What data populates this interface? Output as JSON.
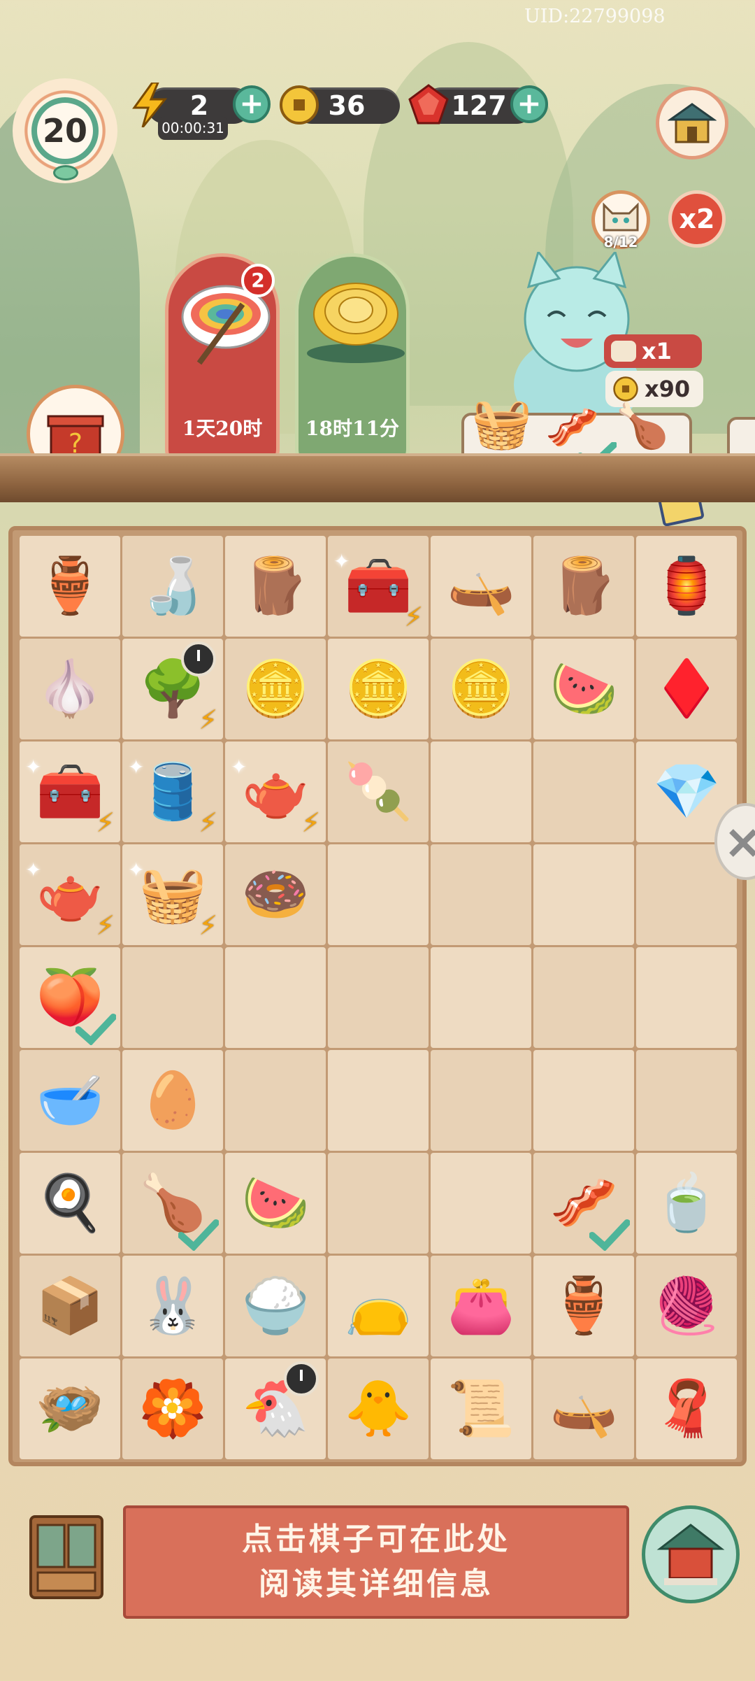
{
  "uid": "UID:22799098",
  "level": "20",
  "resources": {
    "energy": {
      "icon": "lightning-icon",
      "value": "2",
      "timer": "00:00:31"
    },
    "coins": {
      "icon": "coin-icon",
      "value": "36"
    },
    "gems": {
      "icon": "ruby-icon",
      "value": "127"
    }
  },
  "orders": [
    {
      "icon": "rainbow-paint-bowl-icon",
      "badge": "2",
      "time": "1天20时"
    },
    {
      "icon": "chrysanthemum-icon",
      "time": "18时11分"
    }
  ],
  "customer": {
    "progress": "8/12",
    "multiplier": "x2",
    "reward_count": "x1",
    "reward_coins": "x90"
  },
  "board": {
    "rows": [
      [
        "🏺",
        "🍶",
        "🪵",
        "🧰",
        "🛶",
        "🪵",
        "🏮"
      ],
      [
        "🧄",
        "🌳",
        "🪙",
        "🪙",
        "🪙",
        "🍉",
        "♦️"
      ],
      [
        "🧰",
        "🛢️",
        "🫖",
        "🍡",
        "",
        "",
        "💎"
      ],
      [
        "🫖",
        "🧺",
        "🍩",
        "",
        "",
        "",
        ""
      ],
      [
        "🍑",
        "",
        "",
        "",
        "",
        "",
        ""
      ],
      [
        "🥣",
        "🥚",
        "",
        "",
        "",
        "",
        ""
      ],
      [
        "🍳",
        "🍗",
        "🍉",
        "",
        "",
        "🥓",
        "🍵"
      ],
      [
        "📦",
        "🐰",
        "🍚",
        "👝",
        "👛",
        "🏺",
        "🧶"
      ],
      [
        "🪺",
        "🏵️",
        "🐔",
        "🐥",
        "📜",
        "🛶",
        "🧣"
      ]
    ]
  },
  "info": {
    "line1": "点击棋子可在此处",
    "line2": "阅读其详细信息"
  },
  "colors": {
    "accent": "#5ab89b",
    "order_red": "#c94a43",
    "order_green": "#7fa872",
    "info_bg": "#d9705a"
  }
}
